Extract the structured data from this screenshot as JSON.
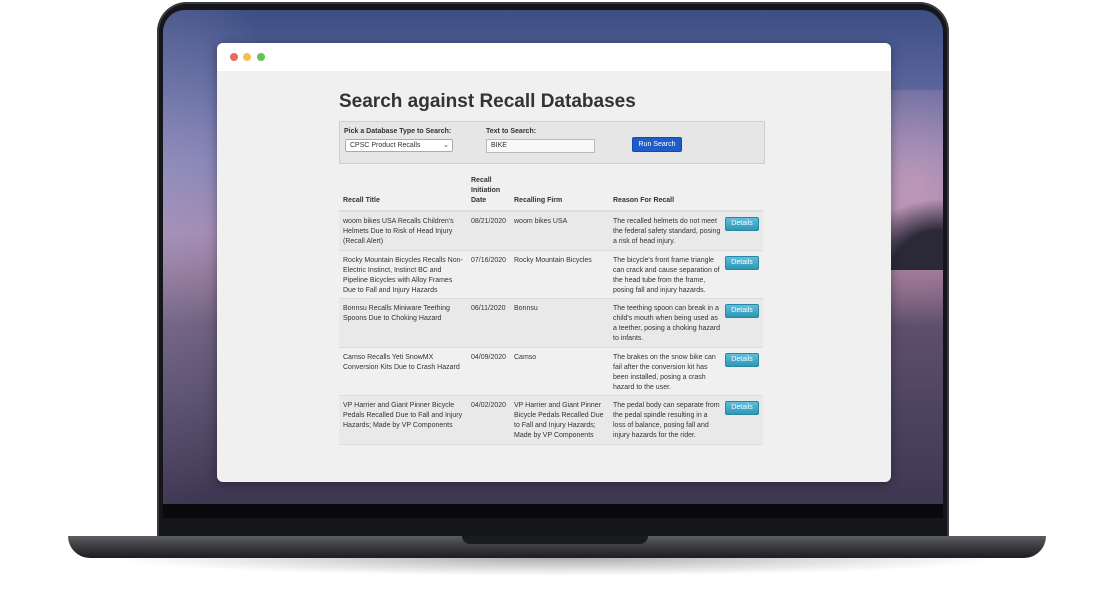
{
  "page": {
    "title": "Search against Recall Databases"
  },
  "search": {
    "db_label": "Pick a Database Type to Search:",
    "db_selected": "CPSC Product Recalls",
    "text_label": "Text to Search:",
    "text_value": "BIKE",
    "run_label": "Run Search"
  },
  "table": {
    "headers": {
      "title": "Recall Title",
      "date_line1": "Recall",
      "date_line2": "Initiation",
      "date_line3": "Date",
      "firm": "Recalling Firm",
      "reason": "Reason For Recall"
    },
    "details_label": "Details",
    "rows": [
      {
        "title": "woom bikes USA Recalls Children's Helmets Due to Risk of Head Injury (Recall Alert)",
        "date": "08/21/2020",
        "firm": "woom bikes USA",
        "reason": "The recalled helmets do not meet the federal safety standard, posing a risk of head injury."
      },
      {
        "title": "Rocky Mountain Bicycles Recalls Non-Electric Instinct, Instinct BC and Pipeline Bicycles with Alloy Frames Due to Fall and Injury Hazards",
        "date": "07/16/2020",
        "firm": "Rocky Mountain Bicycles",
        "reason": "The bicycle's front frame triangle can crack and cause separation of the head tube from the frame, posing fall and injury hazards."
      },
      {
        "title": "Bonnsu Recalls Miniware Teething Spoons Due to Choking Hazard",
        "date": "06/11/2020",
        "firm": "Bonnsu",
        "reason": "The teething spoon can break in a child's mouth when being used as a teether, posing a choking hazard to infants."
      },
      {
        "title": "Camso Recalls Yeti SnowMX Conversion Kits Due to Crash Hazard",
        "date": "04/09/2020",
        "firm": "Camso",
        "reason": "The brakes on the snow bike can fail after the conversion kit has been installed, posing a crash hazard to the user."
      },
      {
        "title": "VP Harrier and Giant Pinner Bicycle Pedals Recalled Due to Fall and Injury Hazards; Made by VP Components",
        "date": "04/02/2020",
        "firm": "VP Harrier and Giant Pinner Bicycle Pedals Recalled Due to Fall and Injury Hazards; Made by VP Components",
        "reason": "The pedal body can separate from the pedal spindle resulting in a loss of balance, posing fall and injury hazards for the rider."
      }
    ]
  },
  "colors": {
    "run_button": "#1f5cc7",
    "details_button": "#3ba3c9",
    "row_stripe": "#e9e9e9"
  }
}
